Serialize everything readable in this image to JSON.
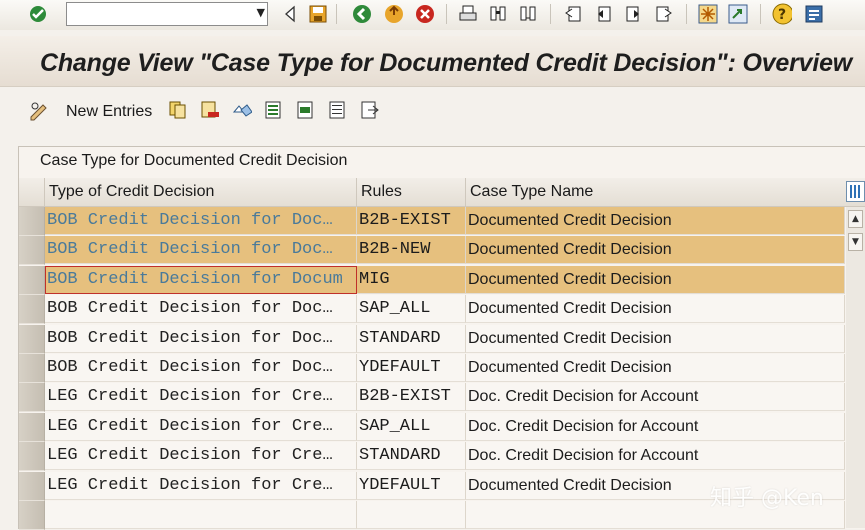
{
  "window": {
    "title": "Change View \"Case Type for Documented Credit Decision\": Overview"
  },
  "system_toolbar": {
    "command_field_value": "",
    "icons": [
      "enter-check-icon",
      "back-arrow-icon",
      "save-icon",
      "back-icon",
      "exit-icon",
      "cancel-icon",
      "print-icon",
      "find-icon",
      "find-next-icon",
      "first-page-icon",
      "previous-page-icon",
      "next-page-icon",
      "last-page-icon",
      "new-session-icon",
      "create-shortcut-icon",
      "help-icon",
      "customize-layout-icon"
    ]
  },
  "app_toolbar": {
    "new_entries_label": "New Entries",
    "icons": [
      "edit-glasses-icon",
      "copy-icon",
      "delete-icon",
      "undo-change-icon",
      "select-all-icon",
      "select-block-icon",
      "deselect-all-icon",
      "print-list-icon"
    ]
  },
  "table": {
    "caption": "Case Type for Documented Credit Decision",
    "columns": [
      "Type of Credit Decision",
      "Rules",
      "Case Type Name"
    ],
    "rows": [
      {
        "type": "BOB Credit Decision for Doc…",
        "rules": "B2B-EXIST",
        "name": "Documented Credit Decision",
        "selected": true
      },
      {
        "type": "BOB Credit Decision for Doc…",
        "rules": "B2B-NEW",
        "name": "Documented Credit Decision",
        "selected": true
      },
      {
        "type": "BOB Credit Decision for Docum",
        "rules": "MIG",
        "name": "Documented Credit Decision",
        "selected": true,
        "focused": true
      },
      {
        "type": "BOB Credit Decision for Doc…",
        "rules": "SAP_ALL",
        "name": "Documented Credit Decision",
        "selected": false
      },
      {
        "type": "BOB Credit Decision for Doc…",
        "rules": "STANDARD",
        "name": "Documented Credit Decision",
        "selected": false
      },
      {
        "type": "BOB Credit Decision for Doc…",
        "rules": "YDEFAULT",
        "name": "Documented Credit Decision",
        "selected": false
      },
      {
        "type": "LEG Credit Decision for Cre…",
        "rules": "B2B-EXIST",
        "name": "Doc. Credit Decision for Account",
        "selected": false
      },
      {
        "type": "LEG Credit Decision for Cre…",
        "rules": "SAP_ALL",
        "name": "Doc. Credit Decision for Account",
        "selected": false
      },
      {
        "type": "LEG Credit Decision for Cre…",
        "rules": "STANDARD",
        "name": "Doc. Credit Decision for Account",
        "selected": false
      },
      {
        "type": "LEG Credit Decision for Cre…",
        "rules": "YDEFAULT",
        "name": "Documented Credit Decision",
        "selected": false
      }
    ]
  },
  "watermark": "知乎 @Ken",
  "colors": {
    "selected_row": "#e6c07e",
    "selected_text": "#4a7a9a",
    "title_text": "#1e1e1e"
  }
}
